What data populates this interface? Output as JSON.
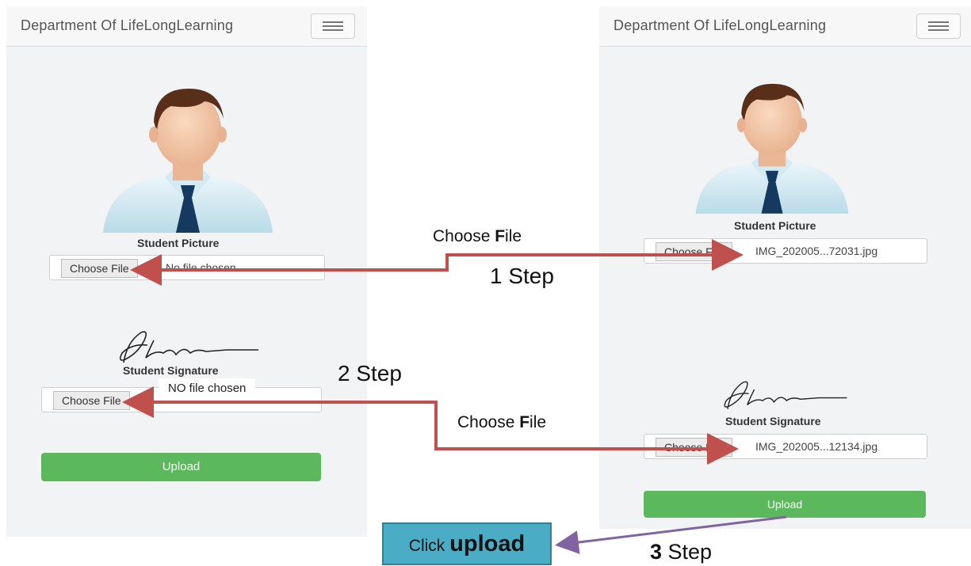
{
  "app": {
    "title": "Department Of LifeLongLearning"
  },
  "left_screen": {
    "picture_caption": "Student Picture",
    "picture_input": {
      "button": "Choose File",
      "filename": "No file chosen"
    },
    "signature_caption": "Student Signature",
    "signature_input": {
      "button": "Choose File",
      "filename": "NO file chosen"
    },
    "upload_label": "Upload"
  },
  "right_screen": {
    "picture_caption": "Student Picture",
    "picture_input": {
      "button": "Choose File",
      "filename": "IMG_202005...72031.jpg"
    },
    "signature_caption": "Student Signature",
    "signature_input": {
      "button": "Choose File",
      "filename": "IMG_202005...12134.jpg"
    },
    "upload_label": "Upload"
  },
  "annotations": {
    "step1_hint_prefix": "Choose ",
    "step1_hint_bold": "F",
    "step1_hint_suffix": "ile",
    "step1_label": "1 Step",
    "step2_label": "2 Step",
    "step2_hint_prefix": "Choose ",
    "step2_hint_bold": "F",
    "step2_hint_suffix": "ile",
    "click_prefix": "Click ",
    "click_bold": "upload",
    "step3_number": "3",
    "step3_word": " Step"
  },
  "icons": {
    "menu": "hamburger-icon",
    "avatar": "student-avatar-icon",
    "signature": "signature-image"
  },
  "colors": {
    "upload_button": "#5cb85c",
    "step_arrow": "#c0504d",
    "upload_arrow": "#8064a2",
    "click_box": "#4bacc6"
  }
}
